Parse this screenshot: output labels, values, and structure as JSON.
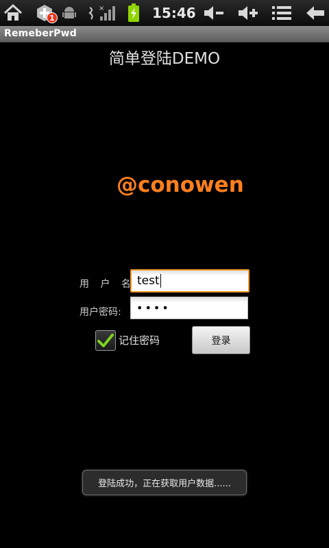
{
  "status_bar": {
    "time": "15:46",
    "notification_badge": "1",
    "icons": [
      "home-icon",
      "add-notification-icon",
      "android-debug-icon",
      "usb-icon",
      "signal-icon",
      "battery-charging-icon",
      "volume-down-icon",
      "volume-up-icon",
      "menu-icon",
      "back-icon"
    ]
  },
  "app": {
    "title": "RemeberPwd"
  },
  "main": {
    "heading": "简单登陆DEMO",
    "brand": "@conowen",
    "username_label": "用 户 名:",
    "username_value": "test",
    "password_label": "用户密码:",
    "password_value": "••••",
    "remember_label": "记住密码",
    "remember_checked": true,
    "login_button": "登录"
  },
  "toast": {
    "message": "登陆成功，正在获取用户数据......"
  },
  "colors": {
    "brand": "#ff7f1e",
    "focus_border": "#f39a2a",
    "check": "#7ed321",
    "battery": "#8fd400"
  }
}
